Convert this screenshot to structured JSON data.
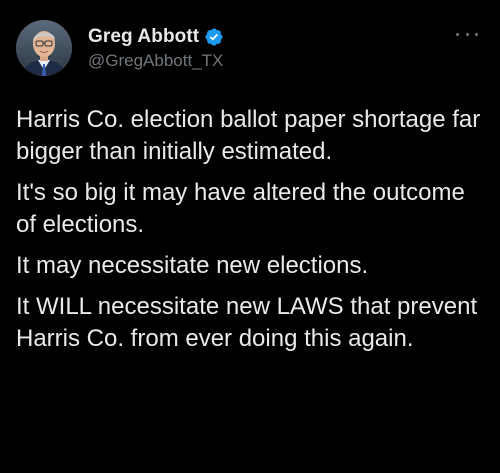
{
  "author": {
    "display_name": "Greg Abbott",
    "handle": "@GregAbbott_TX",
    "verified": true,
    "avatar_icon": "profile-photo-avatar"
  },
  "menu": {
    "icon": "more-options-icon"
  },
  "tweet": {
    "paragraphs": [
      "Harris Co. election ballot paper shortage far bigger than initially estimated.",
      "It's so big it may have altered the outcome of elections.",
      "It may necessitate new elections.",
      "It WILL necessitate new LAWS that prevent Harris Co. from ever doing this again."
    ]
  },
  "colors": {
    "background": "#000000",
    "text_primary": "#e7e9ea",
    "text_secondary": "#71767b",
    "verified_badge": "#1d9bf0"
  }
}
